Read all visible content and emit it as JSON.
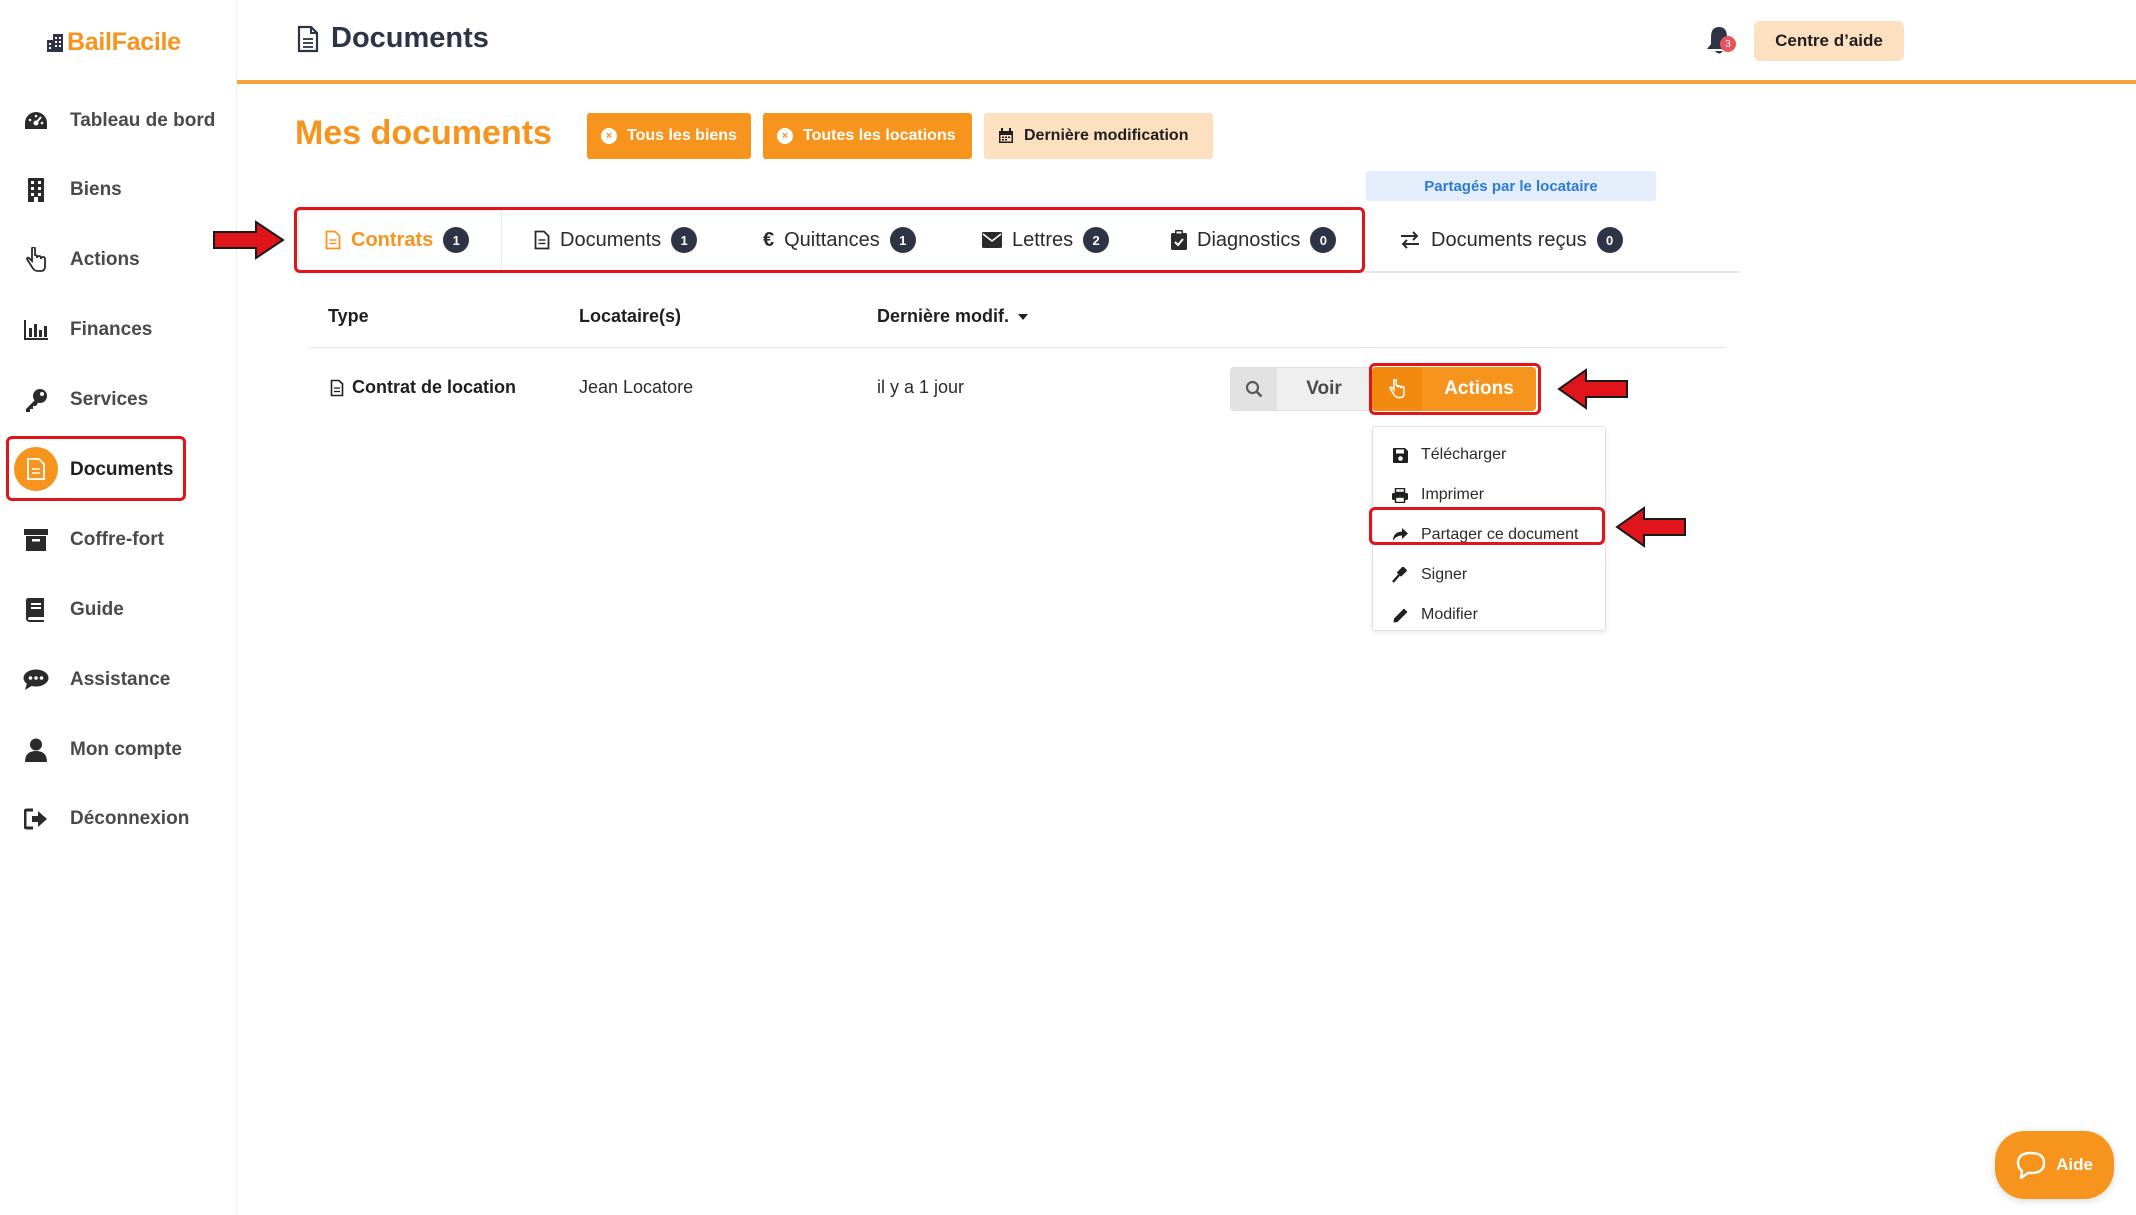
{
  "app": {
    "name": "BailFacile"
  },
  "sidebar": {
    "items": [
      {
        "label": "Tableau de bord",
        "icon": "dashboard-gauge-icon"
      },
      {
        "label": "Biens",
        "icon": "building-icon"
      },
      {
        "label": "Actions",
        "icon": "hand-pointer-icon"
      },
      {
        "label": "Finances",
        "icon": "bar-chart-icon"
      },
      {
        "label": "Services",
        "icon": "key-icon"
      },
      {
        "label": "Documents",
        "icon": "document-icon",
        "active": true
      },
      {
        "label": "Coffre-fort",
        "icon": "archive-box-icon"
      },
      {
        "label": "Guide",
        "icon": "book-icon"
      },
      {
        "label": "Assistance",
        "icon": "chat-bubble-icon"
      },
      {
        "label": "Mon compte",
        "icon": "user-icon"
      },
      {
        "label": "Déconnexion",
        "icon": "sign-out-icon"
      }
    ]
  },
  "header": {
    "title": "Documents",
    "help_center": "Centre d’aide",
    "notifications_count": "3"
  },
  "main": {
    "title": "Mes documents",
    "filters": {
      "all_properties": "Tous les biens",
      "all_rentals": "Toutes les locations",
      "last_modified": "Dernière modification"
    },
    "shared_label": "Partagés par le locataire",
    "tabs": [
      {
        "label": "Contrats",
        "count": "1",
        "active": true
      },
      {
        "label": "Documents",
        "count": "1"
      },
      {
        "label": "Quittances",
        "count": "1"
      },
      {
        "label": "Lettres",
        "count": "2"
      },
      {
        "label": "Diagnostics",
        "count": "0"
      },
      {
        "label": "Documents reçus",
        "count": "0"
      }
    ],
    "table": {
      "headers": {
        "type": "Type",
        "tenants": "Locataire(s)",
        "modified": "Dernière modif."
      },
      "rows": [
        {
          "type": "Contrat de location",
          "tenant": "Jean Locatore",
          "modified": "il y a 1 jour"
        }
      ]
    },
    "row_buttons": {
      "view": "Voir",
      "actions": "Actions"
    },
    "dropdown": [
      {
        "label": "Télécharger",
        "icon": "floppy-disk-icon"
      },
      {
        "label": "Imprimer",
        "icon": "printer-icon"
      },
      {
        "label": "Partager ce document",
        "icon": "share-arrow-icon"
      },
      {
        "label": "Signer",
        "icon": "gavel-icon"
      },
      {
        "label": "Modifier",
        "icon": "pencil-icon"
      }
    ]
  },
  "aide": {
    "label": "Aide"
  },
  "colors": {
    "brand": "#f7941d",
    "light_brand": "#fde0c0",
    "highlight": "#e0141b",
    "dark": "#2e3446"
  }
}
